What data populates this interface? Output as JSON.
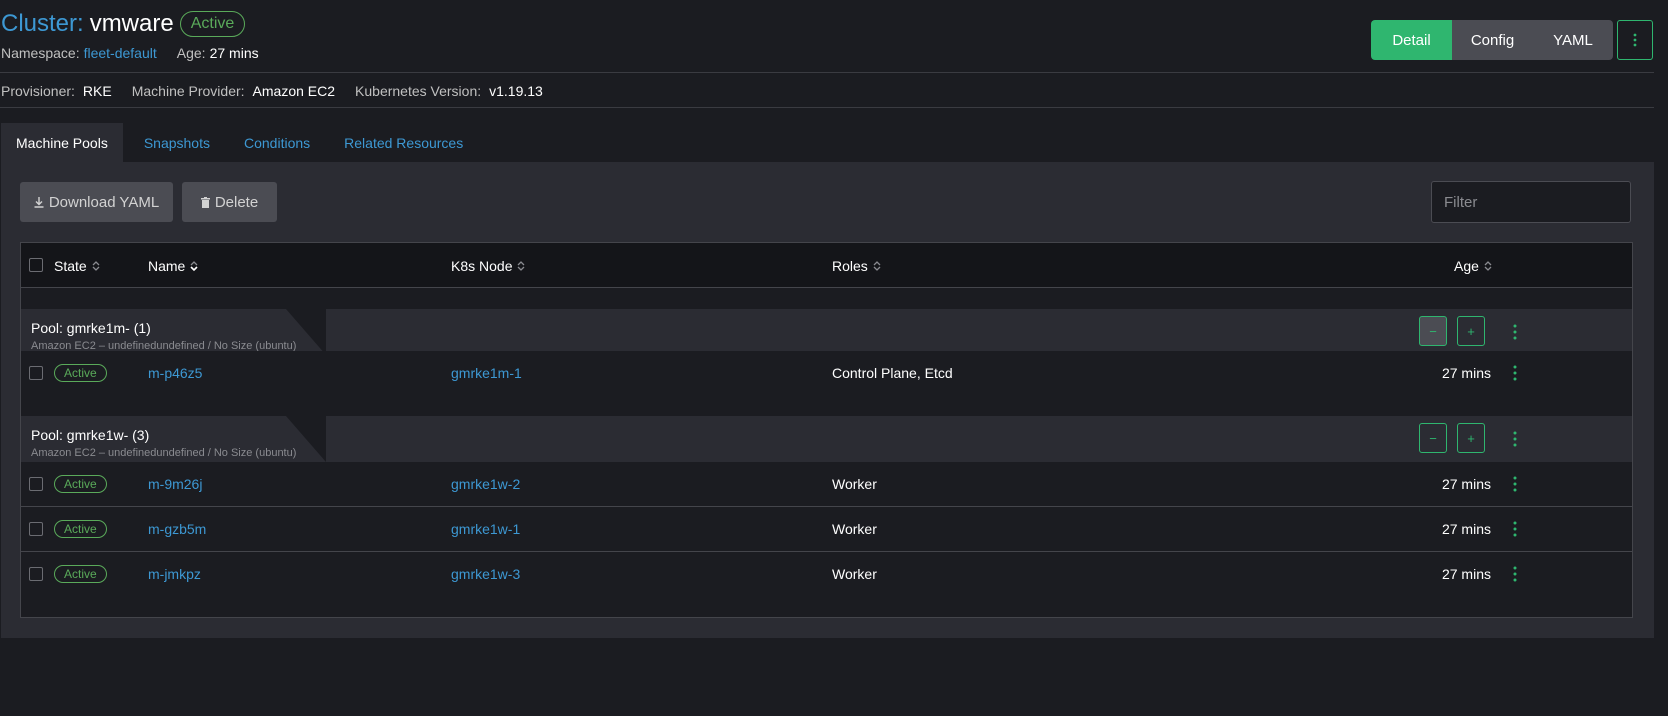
{
  "header": {
    "title_prefix": "Cluster:",
    "title_name": "vmware",
    "status": "Active",
    "namespace_label": "Namespace:",
    "namespace_value": "fleet-default",
    "age_label": "Age:",
    "age_value": "27 mins",
    "view_buttons": [
      "Detail",
      "Config",
      "YAML"
    ],
    "active_view": "Detail"
  },
  "details": {
    "provisioner_label": "Provisioner:",
    "provisioner_value": "RKE",
    "machine_provider_label": "Machine Provider:",
    "machine_provider_value": "Amazon EC2",
    "k8s_version_label": "Kubernetes Version:",
    "k8s_version_value": "v1.19.13"
  },
  "tabs": [
    {
      "label": "Machine Pools",
      "active": true
    },
    {
      "label": "Snapshots",
      "active": false
    },
    {
      "label": "Conditions",
      "active": false
    },
    {
      "label": "Related Resources",
      "active": false
    }
  ],
  "toolbar": {
    "download_label": "Download YAML",
    "delete_label": "Delete",
    "filter_placeholder": "Filter"
  },
  "table": {
    "columns": [
      "State",
      "Name",
      "K8s Node",
      "Roles",
      "Age"
    ],
    "groups": [
      {
        "title": "Pool: gmrke1m- (1)",
        "subtitle": "Amazon EC2 – undefinedundefined / No Size (ubuntu)",
        "scale_down_disabled": true,
        "rows": [
          {
            "state": "Active",
            "name": "m-p46z5",
            "node": "gmrke1m-1",
            "roles": "Control Plane, Etcd",
            "age": "27 mins"
          }
        ]
      },
      {
        "title": "Pool: gmrke1w- (3)",
        "subtitle": "Amazon EC2 – undefinedundefined / No Size (ubuntu)",
        "scale_down_disabled": false,
        "rows": [
          {
            "state": "Active",
            "name": "m-9m26j",
            "node": "gmrke1w-2",
            "roles": "Worker",
            "age": "27 mins"
          },
          {
            "state": "Active",
            "name": "m-gzb5m",
            "node": "gmrke1w-1",
            "roles": "Worker",
            "age": "27 mins"
          },
          {
            "state": "Active",
            "name": "m-jmkpz",
            "node": "gmrke1w-3",
            "roles": "Worker",
            "age": "27 mins"
          }
        ]
      }
    ]
  },
  "colors": {
    "accent_green": "#2fb66f",
    "link_blue": "#3d98d3",
    "status_green": "#5aaa5a",
    "background": "#1b1c21",
    "panel": "#2b2c33"
  },
  "icons": [
    "download-icon",
    "trash-icon",
    "sort-icon",
    "kebab-icon",
    "minus-icon",
    "plus-icon"
  ]
}
